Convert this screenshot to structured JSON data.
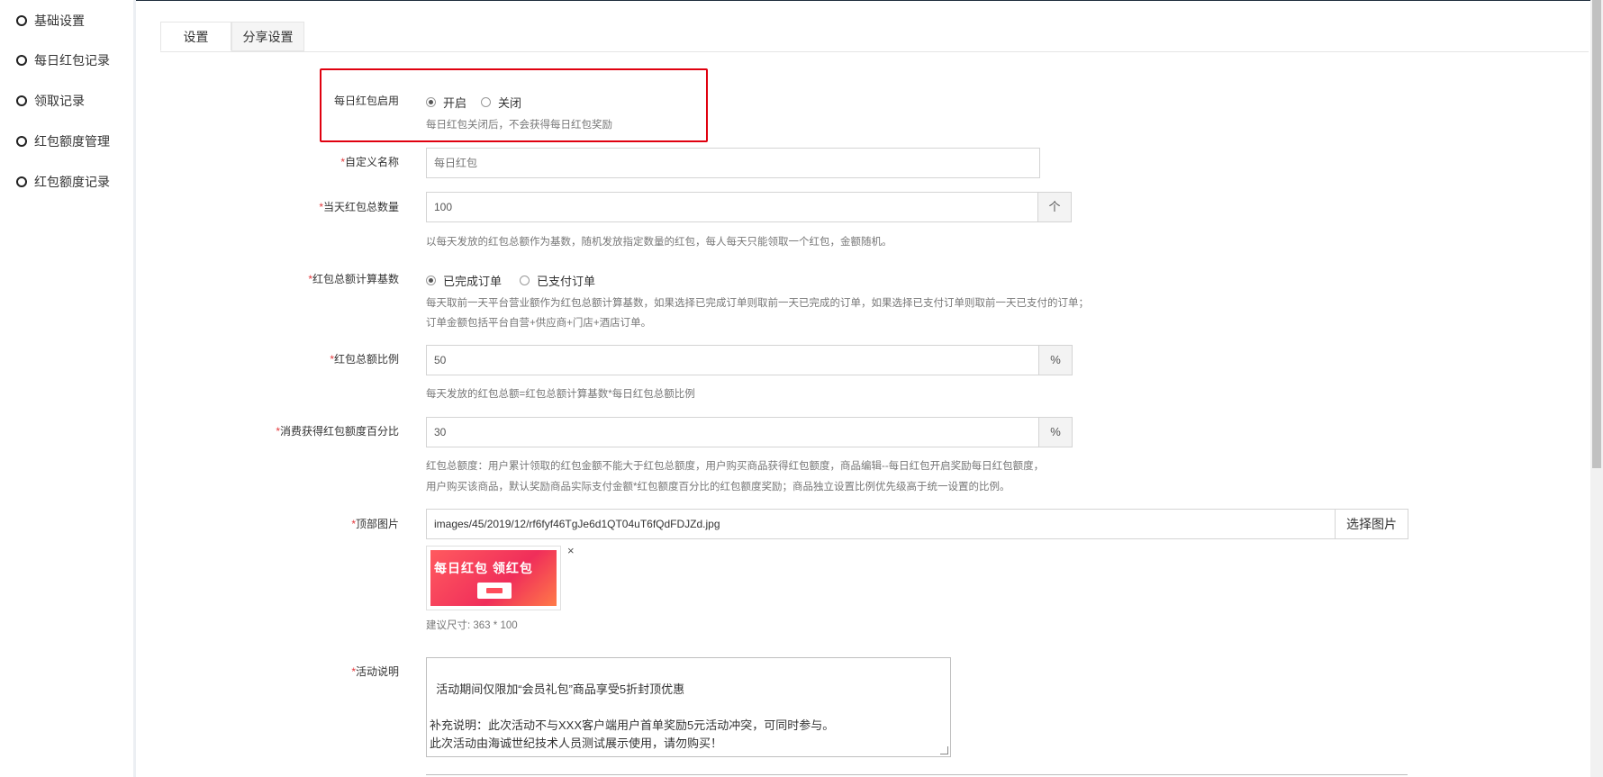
{
  "sidebar": {
    "items": [
      {
        "label": "基础设置"
      },
      {
        "label": "每日红包记录"
      },
      {
        "label": "领取记录"
      },
      {
        "label": "红包额度管理"
      },
      {
        "label": "红包额度记录"
      }
    ]
  },
  "tabs": [
    {
      "label": "设置",
      "active": true
    },
    {
      "label": "分享设置",
      "active": false
    }
  ],
  "form": {
    "enable": {
      "label": "每日红包启用",
      "options": [
        "开启",
        "关闭"
      ],
      "selected": "开启",
      "hint": "每日红包关闭后，不会获得每日红包奖励"
    },
    "custom_name": {
      "required": "*",
      "label": "自定义名称",
      "placeholder": "每日红包"
    },
    "daily_count": {
      "required": "*",
      "label": "当天红包总数量",
      "value": "100",
      "unit": "个",
      "hint": "以每天发放的红包总额作为基数，随机发放指定数量的红包，每人每天只能领取一个红包，金额随机。"
    },
    "calc_base": {
      "required": "*",
      "label": "红包总额计算基数",
      "options": [
        "已完成订单",
        "已支付订单"
      ],
      "selected": "已完成订单",
      "hint_line1": "每天取前一天平台营业额作为红包总额计算基数，如果选择已完成订单则取前一天已完成的订单，如果选择已支付订单则取前一天已支付的订单；",
      "hint_line2": "订单金额包括平台自营+供应商+门店+酒店订单。"
    },
    "total_ratio": {
      "required": "*",
      "label": "红包总额比例",
      "value": "50",
      "unit": "%",
      "hint": "每天发放的红包总额=红包总额计算基数*每日红包总额比例"
    },
    "consume_ratio": {
      "required": "*",
      "label": "消费获得红包额度百分比",
      "value": "30",
      "unit": "%",
      "hint_line1": "红包总额度：用户累计领取的红包金额不能大于红包总额度，用户购买商品获得红包额度，商品编辑--每日红包开启奖励每日红包额度，",
      "hint_line2": "用户购买该商品，默认奖励商品实际支付金额*红包额度百分比的红包额度奖励；商品独立设置比例优先级高于统一设置的比例。"
    },
    "top_image": {
      "required": "*",
      "label": "顶部图片",
      "value": "images/45/2019/12/rf6fyf46TgJe6d1QT04uT6fQdFDJZd.jpg",
      "button": "选择图片",
      "remove": "×",
      "thumb_text": "每日红包 领红包",
      "size_hint": "建议尺寸: 363 * 100"
    },
    "description": {
      "required": "*",
      "label": "活动说明",
      "value": "活动期间仅限加“会员礼包”商品享受5折封顶优惠\n\n补充说明：此次活动不与XXX客户端用户首单奖励5元活动冲突，可同时参与。\n此次活动由海诚世纪技术人员测试展示使用，请勿购买！"
    }
  },
  "colors": {
    "highlight_border": "#e0000f",
    "required_mark": "#e4393c"
  }
}
